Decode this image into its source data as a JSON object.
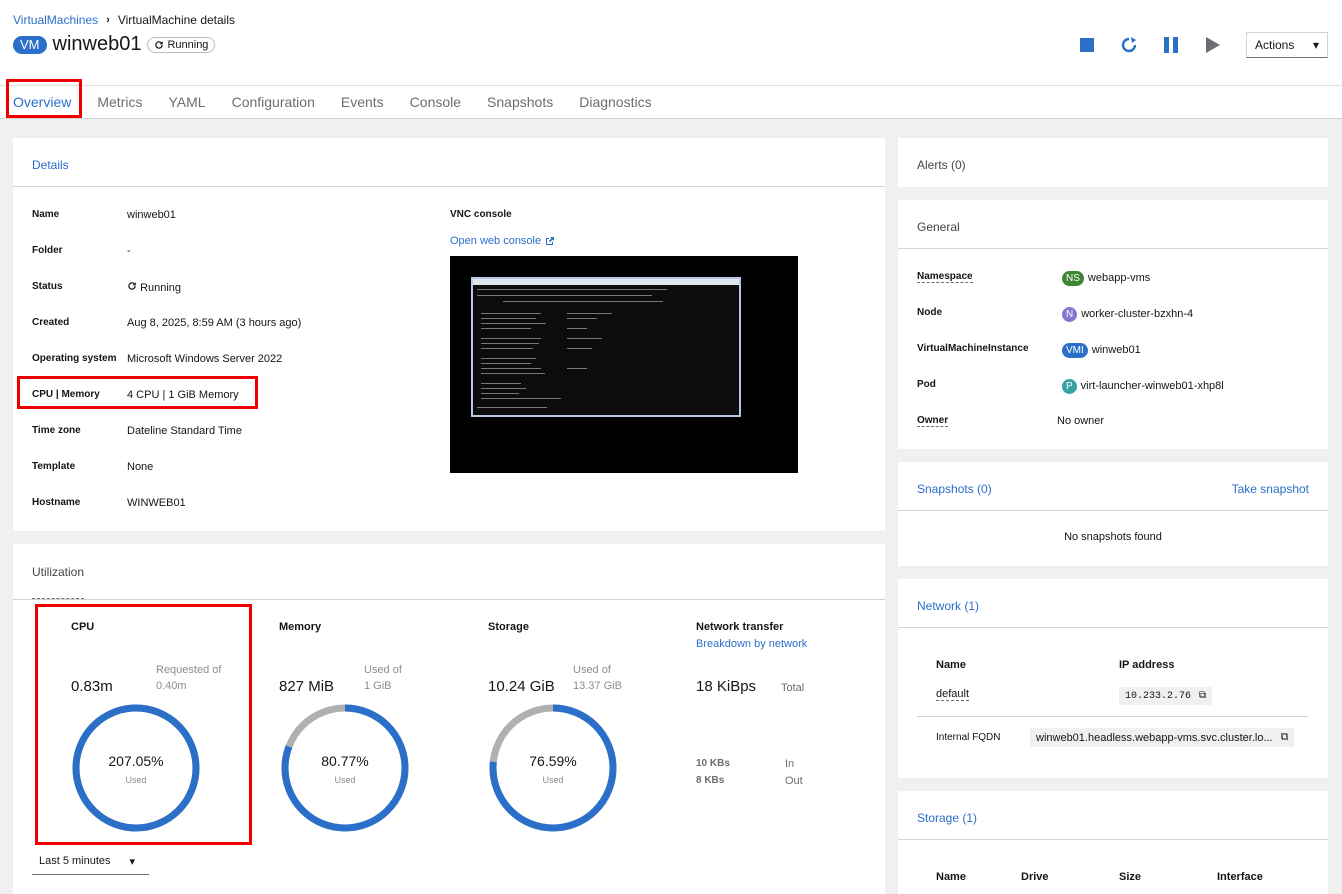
{
  "breadcrumb": {
    "parent": "VirtualMachines",
    "current": "VirtualMachine details"
  },
  "header": {
    "badge": "VM",
    "title": "winweb01",
    "status": "Running"
  },
  "toolbar": {
    "actions_label": "Actions"
  },
  "tabs": [
    "Overview",
    "Metrics",
    "YAML",
    "Configuration",
    "Events",
    "Console",
    "Snapshots",
    "Diagnostics"
  ],
  "details": {
    "heading": "Details",
    "rows": [
      {
        "label": "Name",
        "value": "winweb01"
      },
      {
        "label": "Folder",
        "value": "-"
      },
      {
        "label": "Status",
        "value": "Running"
      },
      {
        "label": "Created",
        "value": "Aug 8, 2025, 8:59 AM (3 hours ago)"
      },
      {
        "label": "Operating system",
        "value": "Microsoft Windows Server 2022"
      },
      {
        "label": "CPU | Memory",
        "value": "4 CPU | 1 GiB Memory"
      },
      {
        "label": "Time zone",
        "value": "Dateline Standard Time"
      },
      {
        "label": "Template",
        "value": "None"
      },
      {
        "label": "Hostname",
        "value": "WINWEB01"
      }
    ],
    "vnc_title": "VNC console",
    "vnc_link": "Open web console"
  },
  "utilization": {
    "heading": "Utilization",
    "cpu": {
      "title": "CPU",
      "value": "0.83m",
      "sub1": "Requested of",
      "sub2": "0.40m",
      "percent_label": "207.05%",
      "used": "Used",
      "fraction": 1.0
    },
    "memory": {
      "title": "Memory",
      "value": "827 MiB",
      "sub1": "Used of",
      "sub2": "1 GiB",
      "percent_label": "80.77%",
      "used": "Used",
      "fraction": 0.8077
    },
    "storage": {
      "title": "Storage",
      "value": "10.24 GiB",
      "sub1": "Used of",
      "sub2": "13.37 GiB",
      "percent_label": "76.59%",
      "used": "Used",
      "fraction": 0.7659
    },
    "network": {
      "title": "Network transfer",
      "link": "Breakdown by network",
      "value": "18 KiBps",
      "total": "Total",
      "in_value": "10 KBs",
      "in_label": "In",
      "out_value": "8 KBs",
      "out_label": "Out"
    },
    "time_range": "Last 5 minutes"
  },
  "alerts": {
    "heading": "Alerts (0)"
  },
  "general": {
    "heading": "General",
    "namespace_label": "Namespace",
    "namespace_badge": "NS",
    "namespace_value": "webapp-vms",
    "node_label": "Node",
    "node_badge": "N",
    "node_value": "worker-cluster-bzxhn-4",
    "vmi_label": "VirtualMachineInstance",
    "vmi_badge": "VMI",
    "vmi_value": "winweb01",
    "pod_label": "Pod",
    "pod_badge": "P",
    "pod_value": "virt-launcher-winweb01-xhp8l",
    "owner_label": "Owner",
    "owner_value": "No owner"
  },
  "snapshots": {
    "heading": "Snapshots (0)",
    "action": "Take snapshot",
    "empty": "No snapshots found"
  },
  "network": {
    "heading": "Network (1)",
    "col_name": "Name",
    "col_ip": "IP address",
    "row_name": "default",
    "row_ip": "10.233.2.76",
    "fqdn_label": "Internal FQDN",
    "fqdn_value": "winweb01.headless.webapp-vms.svc.cluster.lo..."
  },
  "storage": {
    "heading": "Storage (1)",
    "cols": [
      "Name",
      "Drive",
      "Size",
      "Interface"
    ]
  },
  "colors": {
    "accent": "#2b6fc9",
    "gauge_track": "#b0b0b0",
    "highlight": "#ee0000",
    "ns_badge": "#3e8635",
    "node_badge": "#8476d1",
    "pod_badge": "#37a3a3"
  }
}
